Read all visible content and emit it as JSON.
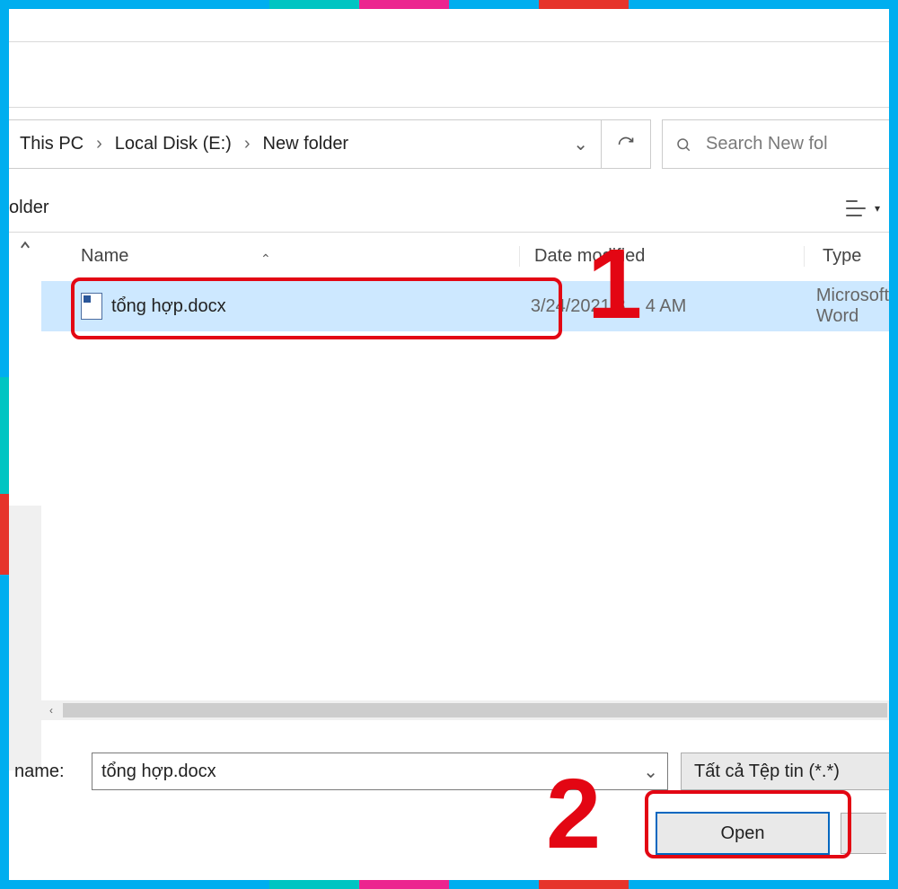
{
  "breadcrumb": {
    "items": [
      "This PC",
      "Local Disk (E:)",
      "New folder"
    ]
  },
  "search": {
    "placeholder": "Search New fol"
  },
  "organize": {
    "fragment": "older"
  },
  "columns": {
    "name": "Name",
    "date": "Date modified",
    "type": "Type"
  },
  "file": {
    "name": "tổng hợp.docx",
    "date0": "3/24/2021 8",
    "date1": "4 AM",
    "type": "Microsoft Word"
  },
  "filename": {
    "label": "name:",
    "value": "tổng hợp.docx"
  },
  "filter": {
    "label": "Tất cả Tệp tin (*.*)"
  },
  "open": {
    "label": "Open"
  },
  "markers": {
    "one": "1",
    "two": "2"
  }
}
